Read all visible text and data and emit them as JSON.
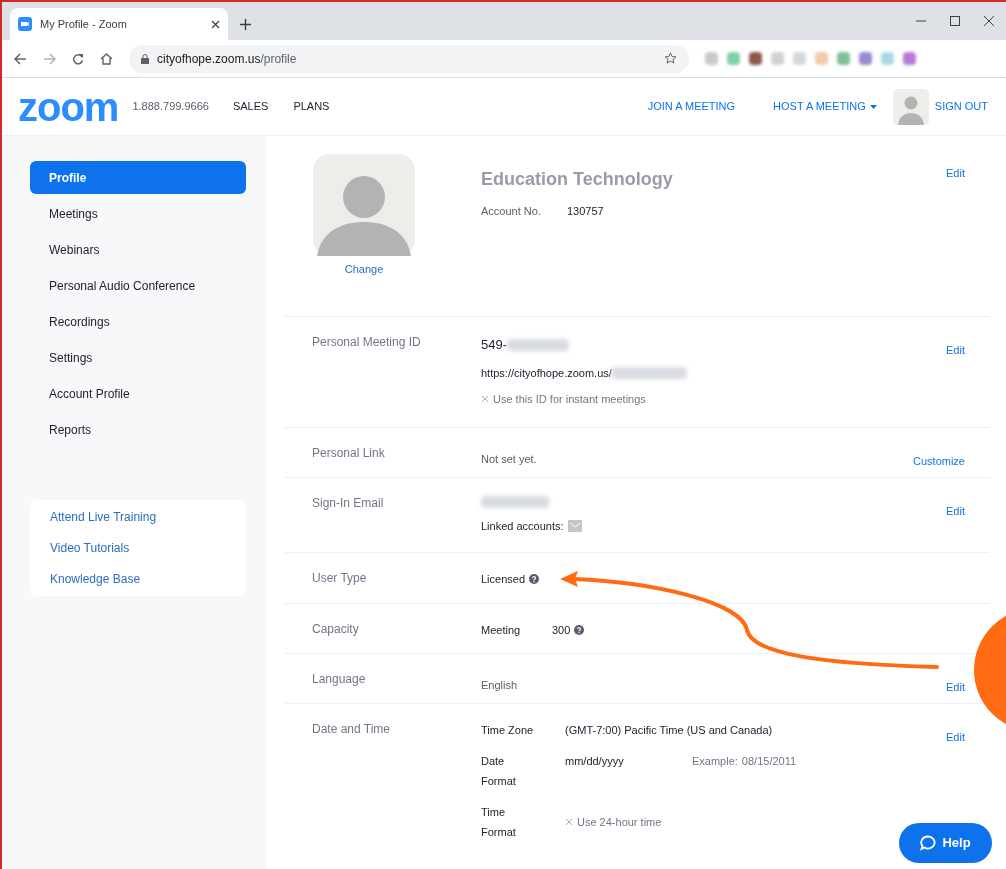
{
  "browser": {
    "tab_title": "My Profile - Zoom",
    "url_host": "cityofhope.zoom.us",
    "url_path": "/profile"
  },
  "header": {
    "logo": "zoom",
    "phone": "1.888.799.9666",
    "nav": [
      "SALES",
      "PLANS"
    ],
    "join": "JOIN A MEETING",
    "host": "HOST A MEETING",
    "sign_out": "SIGN OUT"
  },
  "sidebar": {
    "items": [
      {
        "label": "Profile",
        "selected": true
      },
      {
        "label": "Meetings",
        "selected": false
      },
      {
        "label": "Webinars",
        "selected": false
      },
      {
        "label": "Personal Audio Conference",
        "selected": false
      },
      {
        "label": "Recordings",
        "selected": false
      },
      {
        "label": "Settings",
        "selected": false
      },
      {
        "label": "Account Profile",
        "selected": false
      },
      {
        "label": "Reports",
        "selected": false
      }
    ],
    "help_links": [
      "Attend Live Training",
      "Video Tutorials",
      "Knowledge Base"
    ]
  },
  "profile": {
    "change": "Change",
    "name": "Education Technology",
    "account_label": "Account No.",
    "account_no": "130757",
    "action": "Edit"
  },
  "rows": [
    {
      "kind": "meeting_id",
      "label": "Personal Meeting ID",
      "id_prefix": "549-",
      "url_prefix": "https://cityofhope.zoom.us/",
      "option": {
        "label": "Use this ID for instant meetings",
        "checked": false
      },
      "action": "Edit"
    },
    {
      "kind": "text",
      "label": "Personal Link",
      "value": "Not set yet.",
      "action": "Customize"
    },
    {
      "kind": "email",
      "label": "Sign-In Email",
      "linked_label": "Linked accounts:",
      "action": "Edit"
    },
    {
      "kind": "help_value",
      "label": "User Type",
      "value": "Licensed"
    },
    {
      "kind": "capacity",
      "label": "Capacity",
      "sub_label": "Meeting",
      "value": "300"
    },
    {
      "kind": "text",
      "label": "Language",
      "value": "English",
      "action": "Edit"
    },
    {
      "kind": "datetime",
      "label": "Date and Time",
      "time_zone_label": "Time Zone",
      "time_zone": "(GMT-7:00) Pacific Time (US and Canada)",
      "date_label": [
        "Date",
        "Format"
      ],
      "date_format": "mm/dd/yyyy",
      "example_label": "Example:",
      "example": "08/15/2011",
      "time_label": [
        "Time",
        "Format"
      ],
      "option": {
        "label": "Use 24-hour time",
        "checked": false
      },
      "action": "Edit"
    }
  ],
  "help_button": "Help"
}
